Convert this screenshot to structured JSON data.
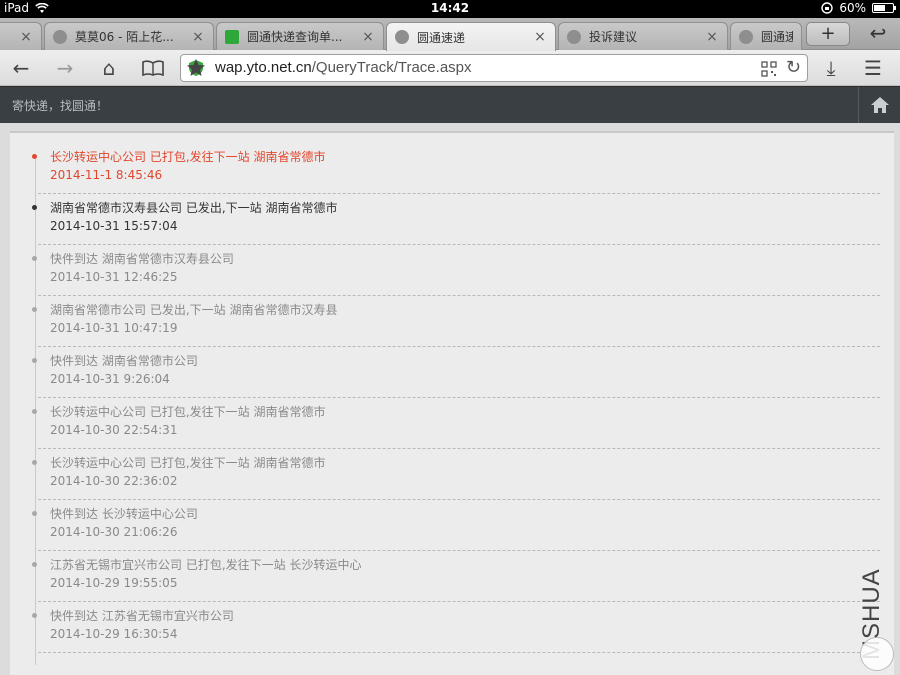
{
  "statusbar": {
    "device": "iPad",
    "time": "14:42",
    "battery": "60%",
    "battery_level": 0.6
  },
  "tabs": [
    {
      "title": "莫莫06 - 陌上花...",
      "close": "×"
    },
    {
      "title": "圆通快递查询单...",
      "close": "×"
    },
    {
      "title": "圆通速递",
      "close": "×"
    },
    {
      "title": "投诉建议",
      "close": "×"
    },
    {
      "title": "圆通速",
      "close": "×"
    }
  ],
  "tabbar": {
    "new_tab": "+",
    "back": "↩"
  },
  "navbar": {
    "url_host": "wap.yto.net.cn",
    "url_path": "/QueryTrack/Trace.aspx",
    "back": "←",
    "forward": "→",
    "home": "⌂",
    "reload": "↻",
    "download": "⤓",
    "menu": "☰"
  },
  "site": {
    "slogan": "寄快递，找圆通！"
  },
  "timeline": [
    {
      "desc": "长沙转运中心公司 已打包,发往下一站 湖南省常德市",
      "time": "2014-11-1 8:45:46"
    },
    {
      "desc": "湖南省常德市汉寿县公司 已发出,下一站 湖南省常德市",
      "time": "2014-10-31 15:57:04"
    },
    {
      "desc": "快件到达 湖南省常德市汉寿县公司",
      "time": "2014-10-31 12:46:25"
    },
    {
      "desc": "湖南省常德市公司 已发出,下一站 湖南省常德市汉寿县",
      "time": "2014-10-31 10:47:19"
    },
    {
      "desc": "快件到达 湖南省常德市公司",
      "time": "2014-10-31 9:26:04"
    },
    {
      "desc": "长沙转运中心公司 已打包,发往下一站 湖南省常德市",
      "time": "2014-10-30 22:54:31"
    },
    {
      "desc": "长沙转运中心公司 已打包,发往下一站 湖南省常德市",
      "time": "2014-10-30 22:36:02"
    },
    {
      "desc": "快件到达 长沙转运中心公司",
      "time": "2014-10-30 21:06:26"
    },
    {
      "desc": "江苏省无锡市宜兴市公司 已打包,发往下一站 长沙转运中心",
      "time": "2014-10-29 19:55:05"
    },
    {
      "desc": "快件到达 江苏省无锡市宜兴市公司",
      "time": "2014-10-29 16:30:54"
    }
  ],
  "watermark": "MSHUA",
  "colors": {
    "latest": "#e0472e",
    "header_bg": "#3a3f43"
  }
}
